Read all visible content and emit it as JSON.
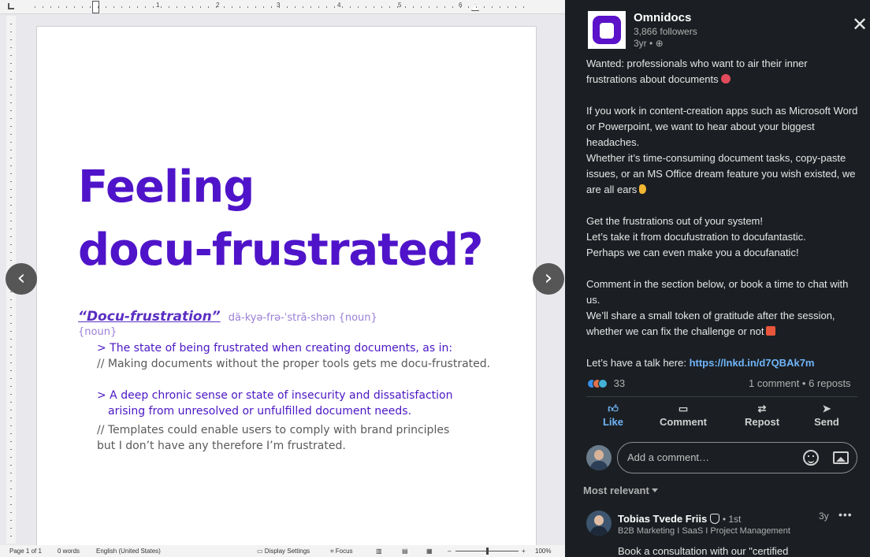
{
  "document": {
    "heading_line1": "Feeling",
    "heading_line2": "docu-frustrated?",
    "term": "“Docu-frustration”",
    "pronunciation": "dä-kyə-frə-ˈstrā-shən {noun}",
    "noun_tag": "{noun}",
    "definition1": "> The state of being frustrated when creating documents, as in:",
    "example1": "// Making documents without the proper tools gets me docu-frustrated.",
    "definition2_line1": "> A deep chronic sense or state of insecurity and dissatisfaction",
    "definition2_line2": "arising from unresolved or unfulfilled document needs.",
    "example2_line1": "//  Templates could enable users to comply with brand principles",
    "example2_line2": "but I don’t have any therefore I’m frustrated.",
    "heading_color": "#4f14c9"
  },
  "navigation": {
    "prev_arrow": "‹",
    "next_arrow": "›"
  },
  "status_bar": {
    "page": "Page 1 of 1",
    "words": "0 words",
    "language": "English (United States)",
    "display_settings": "Display Settings",
    "focus": "Focus",
    "zoom_minus": "–",
    "zoom_plus": "+",
    "zoom": "100%"
  },
  "post": {
    "company_name": "Omnidocs",
    "followers": "3,866 followers",
    "time": "3yr •",
    "brand_color": "#5b12c9",
    "paragraph1_line1": "Wanted: professionals who want to air their inner",
    "paragraph1_line2": "frustrations about documents",
    "paragraph2": "If you work in content-creation apps such as Microsoft Word or Powerpoint, we want to hear about your biggest headaches.",
    "paragraph3": "Whether it’s time-consuming document tasks, copy-paste issues, or an MS Office dream feature you wish existed, we are all ears",
    "paragraph4_line1": "Get the frustrations out of your system!",
    "paragraph4_line2": "Let’s take it from docufustration to docufantastic.",
    "paragraph4_line3": "Perhaps we can even make you a docufanatic!",
    "paragraph5": "Comment in the section below, or book a time to chat with us.",
    "paragraph6": "We’ll share a small token of gratitude after the session, whether we can fix the challenge or not",
    "talk_prefix": "Let’s have a talk here: ",
    "link": "https://lnkd.in/d7QBAk7m",
    "link_color": "#70b5f9"
  },
  "engagement": {
    "reaction_count": "33",
    "comments_reposts": "1 comment • 6 reposts"
  },
  "actions": {
    "like": "Like",
    "comment": "Comment",
    "repost": "Repost",
    "send": "Send"
  },
  "comment_box": {
    "placeholder": "Add a comment…"
  },
  "sort": {
    "label": "Most relevant"
  },
  "comment": {
    "author": "Tobias Tvede Friis",
    "degree": "• 1st",
    "headline": "B2B Marketing I SaaS I Project Management",
    "time": "3y",
    "more": "•••",
    "text": "Book a consultation with our \"certified"
  }
}
